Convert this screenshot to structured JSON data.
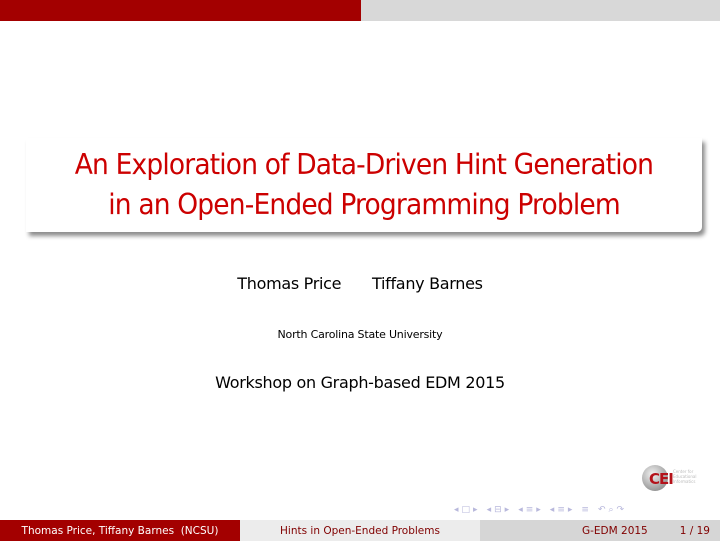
{
  "slide": {
    "title_lines": [
      "An Exploration of Data-Driven Hint Generation",
      "in an Open-Ended Programming Problem"
    ],
    "authors": [
      "Thomas Price",
      "Tiffany Barnes"
    ],
    "institute": "North Carolina State University",
    "event": "Workshop on Graph-based EDM 2015"
  },
  "logo": {
    "mark": "CEI",
    "text_lines": [
      "Center for",
      "Educational",
      "Informatics"
    ]
  },
  "navigation": {
    "symbols": [
      "◂",
      "□",
      "▸",
      "◂",
      "⊟",
      "▸",
      "◂",
      "≡",
      "▸",
      "◂",
      "≡",
      "▸",
      "≡",
      "↶",
      "⌕",
      "↷"
    ]
  },
  "footer": {
    "authors": "Thomas Price, Tiffany Barnes  (NCSU)",
    "short_title": "Hints in Open-Ended Problems",
    "conference": "G-EDM 2015",
    "page": "1 / 19"
  },
  "colors": {
    "accent_red": "#a30000",
    "title_red": "#cc0000",
    "light_gray": "#d8d8d8"
  }
}
